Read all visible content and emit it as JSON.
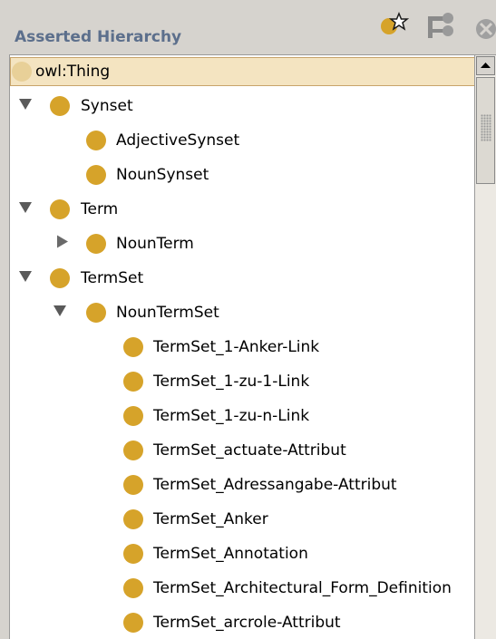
{
  "panel": {
    "title": "Asserted Hierarchy",
    "toolbar": [
      {
        "icon": "add-subclass-icon"
      },
      {
        "icon": "add-sibling-icon"
      },
      {
        "icon": "delete-class-icon"
      }
    ]
  },
  "tree": {
    "root": "owl:Thing",
    "nodes": [
      {
        "label": "Synset",
        "expanded": true
      },
      {
        "label": "AdjectiveSynset"
      },
      {
        "label": "NounSynset"
      },
      {
        "label": "Term",
        "expanded": true
      },
      {
        "label": "NounTerm",
        "expanded": false
      },
      {
        "label": "TermSet",
        "expanded": true
      },
      {
        "label": "NounTermSet",
        "expanded": true
      },
      {
        "label": "TermSet_1-Anker-Link"
      },
      {
        "label": "TermSet_1-zu-1-Link"
      },
      {
        "label": "TermSet_1-zu-n-Link"
      },
      {
        "label": "TermSet_actuate-Attribut"
      },
      {
        "label": "TermSet_Adressangabe-Attribut"
      },
      {
        "label": "TermSet_Anker"
      },
      {
        "label": "TermSet_Annotation"
      },
      {
        "label": "TermSet_Architectural_Form_Definition"
      },
      {
        "label": "TermSet_arcrole-Attribut"
      }
    ]
  },
  "colors": {
    "class_circle": "#d6a32a",
    "selection_bg": "#f4e4c1",
    "title_text": "#5c6f8c"
  }
}
